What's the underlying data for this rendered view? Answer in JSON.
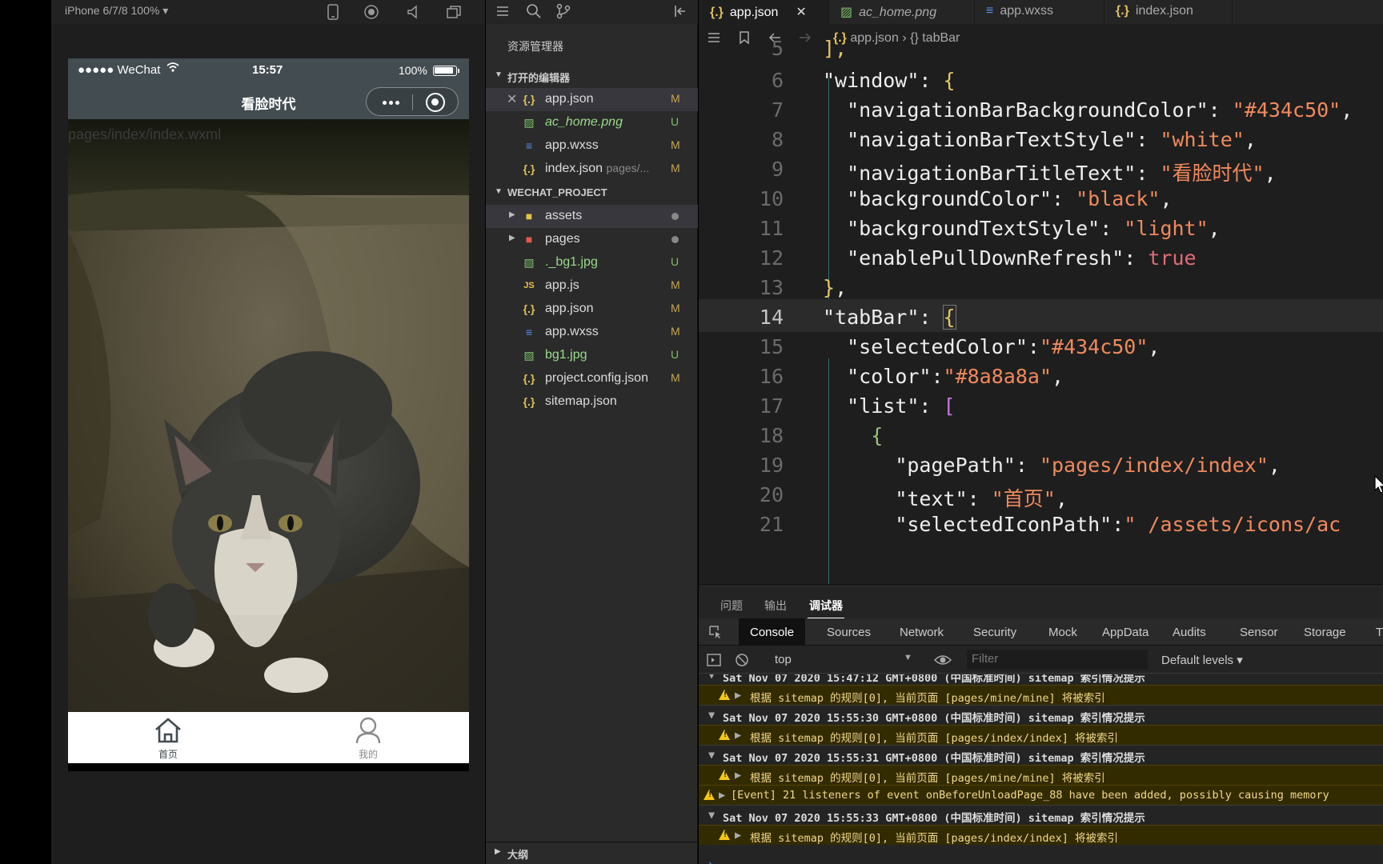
{
  "simulator": {
    "device_label": "iPhone 6/7/8 100% ▾",
    "status": {
      "carrier": "●●●●● WeChat",
      "time": "15:57",
      "battery": "100%"
    },
    "nav_title": "看脸时代",
    "page_path": "pages/index/index.wxml",
    "tabbar": [
      {
        "label": "首页",
        "icon": "home-icon",
        "selected": true
      },
      {
        "label": "我的",
        "icon": "user-icon",
        "selected": false
      }
    ],
    "colors": {
      "nav_bg": "#434c50",
      "selected": "#434c50",
      "unselected": "#8a8a8a"
    }
  },
  "explorer": {
    "title": "资源管理器",
    "open_editors_label": "打开的编辑器",
    "open_editors": [
      {
        "name": "app.json",
        "status": "M",
        "icon": "json-icon"
      },
      {
        "name": "ac_home.png",
        "status": "U",
        "icon": "image-icon"
      },
      {
        "name": "app.wxss",
        "status": "M",
        "icon": "css-icon"
      },
      {
        "name": "index.json",
        "sub": "pages/...",
        "status": "M",
        "icon": "json-icon"
      }
    ],
    "project_label": "WECHAT_PROJECT",
    "project_files": [
      {
        "name": "assets",
        "status": "",
        "icon": "folder-icon"
      },
      {
        "name": "pages",
        "status": "",
        "icon": "folder-icon"
      },
      {
        "name": "._bg1.jpg",
        "status": "U",
        "icon": "image-icon"
      },
      {
        "name": "app.js",
        "status": "M",
        "icon": "js-icon"
      },
      {
        "name": "app.json",
        "status": "M",
        "icon": "json-icon"
      },
      {
        "name": "app.wxss",
        "status": "M",
        "icon": "css-icon"
      },
      {
        "name": "bg1.jpg",
        "status": "U",
        "icon": "image-icon"
      },
      {
        "name": "project.config.json",
        "status": "M",
        "icon": "json-icon"
      },
      {
        "name": "sitemap.json",
        "status": "",
        "icon": "json-icon"
      }
    ],
    "outline_label": "大纲"
  },
  "editor": {
    "tabs": [
      {
        "label": "app.json",
        "icon": "json-icon",
        "active": true
      },
      {
        "label": "ac_home.png",
        "icon": "image-icon",
        "active": false
      },
      {
        "label": "app.wxss",
        "icon": "css-icon",
        "active": false
      },
      {
        "label": "index.json",
        "icon": "json-icon",
        "active": false
      }
    ],
    "breadcrumb": {
      "file": "app.json",
      "separator": "›",
      "symbol": "{} tabBar"
    },
    "line_numbers": [
      "5",
      "6",
      "7",
      "8",
      "9",
      "10",
      "11",
      "12",
      "13",
      "14",
      "15",
      "16",
      "17",
      "18",
      "19",
      "20",
      "21"
    ],
    "highlighted_line": "14"
  },
  "panel": {
    "tabs": [
      "问题",
      "输出",
      "调试器"
    ],
    "active_tab": "调试器",
    "devtools_tabs": [
      "Console",
      "Sources",
      "Network",
      "Security",
      "Mock",
      "AppData",
      "Audits",
      "Sensor",
      "Storage",
      "T"
    ],
    "context": "top",
    "filter_placeholder": "Filter",
    "levels": "Default levels ▾",
    "logs": [
      {
        "type": "group",
        "text": "Sat Nov 07 2020 15:47:12 GMT+0800 (中国标准时间) sitemap 索引情况提示"
      },
      {
        "type": "warn",
        "text": "根据 sitemap 的规则[0], 当前页面 [pages/mine/mine] 将被索引"
      },
      {
        "type": "group",
        "text": "Sat Nov 07 2020 15:55:30 GMT+0800 (中国标准时间) sitemap 索引情况提示"
      },
      {
        "type": "warn",
        "text": "根据 sitemap 的规则[0], 当前页面 [pages/index/index] 将被索引"
      },
      {
        "type": "group",
        "text": "Sat Nov 07 2020 15:55:31 GMT+0800 (中国标准时间) sitemap 索引情况提示"
      },
      {
        "type": "warn",
        "text": "根据 sitemap 的规则[0], 当前页面 [pages/mine/mine] 将被索引"
      },
      {
        "type": "warn-event",
        "text": "[Event] 21 listeners of event onBeforeUnloadPage_88 have been added, possibly causing memory"
      },
      {
        "type": "group",
        "text": "Sat Nov 07 2020 15:55:33 GMT+0800 (中国标准时间) sitemap 索引情况提示"
      },
      {
        "type": "warn",
        "text": "根据 sitemap 的规则[0], 当前页面 [pages/index/index] 将被索引"
      }
    ]
  }
}
